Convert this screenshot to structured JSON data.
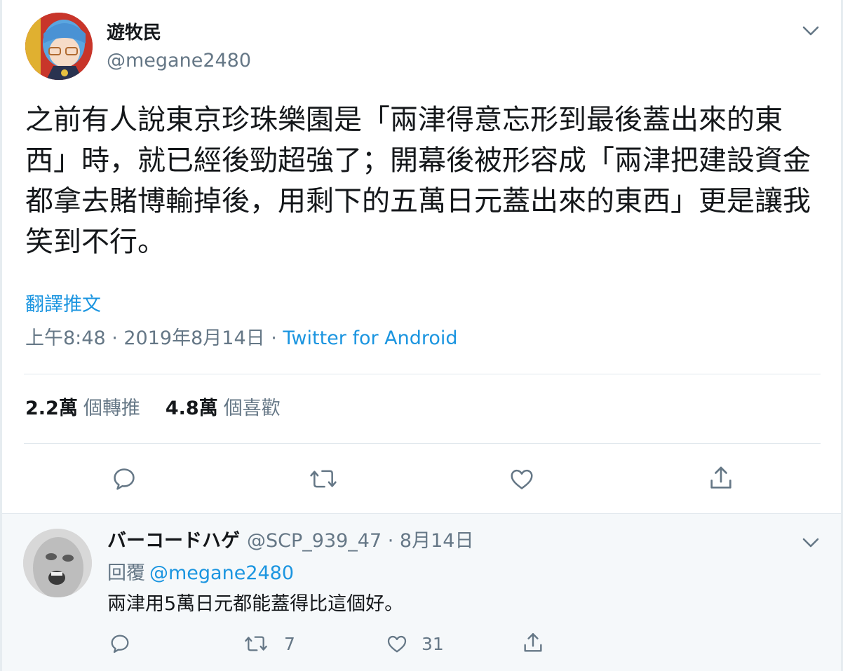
{
  "tweet": {
    "display_name": "遊牧民",
    "handle": "@megane2480",
    "text": "之前有人說東京珍珠樂園是「兩津得意忘形到最後蓋出來的東西」時，就已經後勁超強了；開幕後被形容成「兩津把建設資金都拿去賭博輸掉後，用剩下的五萬日元蓋出來的東西」更是讓我笑到不行。",
    "translate_label": "翻譯推文",
    "time": "上午8:48 · 2019年8月14日 · ",
    "source": "Twitter for Android",
    "retweet_count": "2.2萬",
    "retweet_label": "個轉推",
    "like_count": "4.8萬",
    "like_label": "個喜歡"
  },
  "reply": {
    "display_name": "バーコードハゲ",
    "meta": "@SCP_939_47 · 8月14日",
    "replying_label": "回覆",
    "replying_to": "@megane2480",
    "text": "兩津用5萬日元都能蓋得比這個好。",
    "retweet_count": "7",
    "like_count": "31"
  },
  "colors": {
    "accent": "#1b95e0",
    "muted": "#657786",
    "text": "#14171a",
    "divider": "#e1e8ed",
    "reply_bg": "#f5f8fa"
  },
  "icons": [
    "chevron-down-icon",
    "reply-icon",
    "retweet-icon",
    "like-icon",
    "share-icon"
  ]
}
